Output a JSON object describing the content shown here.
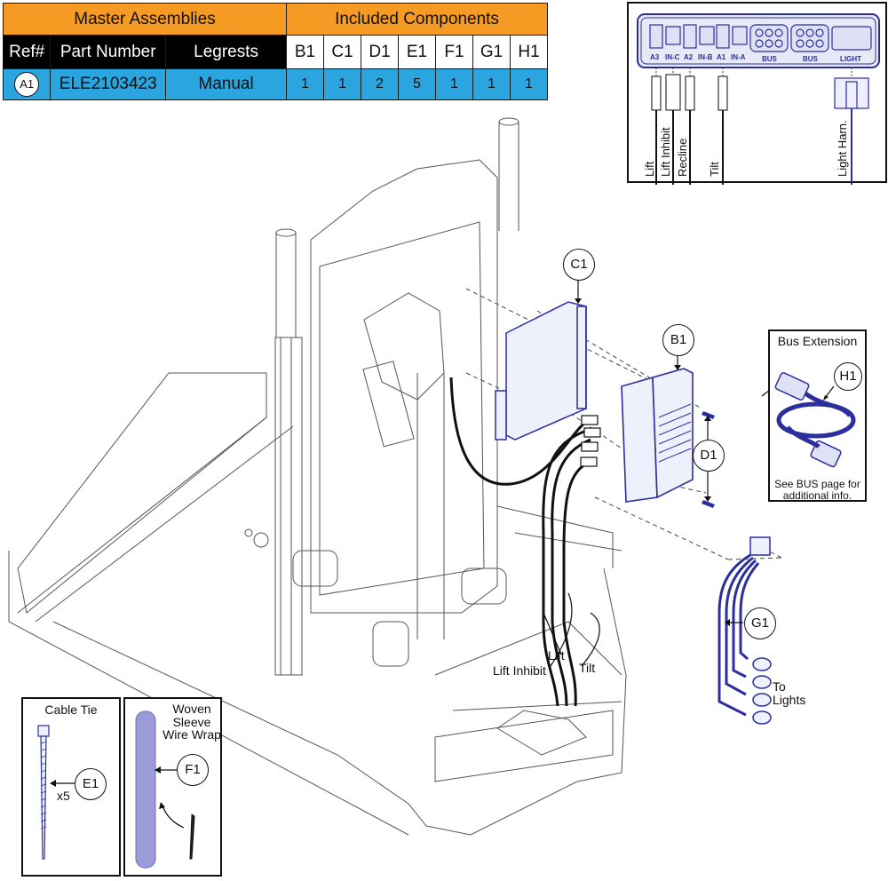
{
  "table": {
    "group_headers": {
      "master": "Master Assemblies",
      "included": "Included Components"
    },
    "columns": {
      "ref": "Ref#",
      "part_number": "Part Number",
      "legrests": "Legrests"
    },
    "component_columns": [
      "B1",
      "C1",
      "D1",
      "E1",
      "F1",
      "G1",
      "H1"
    ],
    "rows": [
      {
        "ref": "A1",
        "part_number": "ELE2103423",
        "legrests": "Manual",
        "quantities": [
          "1",
          "1",
          "2",
          "5",
          "1",
          "1",
          "1"
        ]
      }
    ],
    "colors": {
      "header": "#f59a23",
      "column_header_dark": "#000000",
      "row": "#2aa5df"
    }
  },
  "connector_panel": {
    "ports": [
      "A3",
      "IN-C",
      "A2",
      "IN-B",
      "A1",
      "IN-A",
      "BUS",
      "BUS",
      "LIGHT"
    ],
    "wires": [
      "Lift",
      "Lift Inhibit",
      "Recline",
      "Tilt",
      "Light Harn."
    ],
    "color": "#2b2f9e"
  },
  "bus_extension": {
    "title": "Bus Extension",
    "callout": "H1",
    "note_line1": "See BUS page for",
    "note_line2": "additional info."
  },
  "cable_tie": {
    "title": "Cable Tie",
    "callout": "E1",
    "qty": "x5"
  },
  "wire_wrap": {
    "title_line1": "Woven",
    "title_line2": "Sleeve",
    "title_line3": "Wire Wrap",
    "callout": "F1"
  },
  "callouts": {
    "c1": "C1",
    "b1": "B1",
    "d1": "D1",
    "g1": "G1"
  },
  "cable_labels": {
    "lift": "Lift",
    "lift_inhibit": "Lift Inhibit",
    "tilt": "Tilt"
  },
  "lights": {
    "line1": "To",
    "line2": "Lights"
  },
  "part_color": "#2b2f9e"
}
